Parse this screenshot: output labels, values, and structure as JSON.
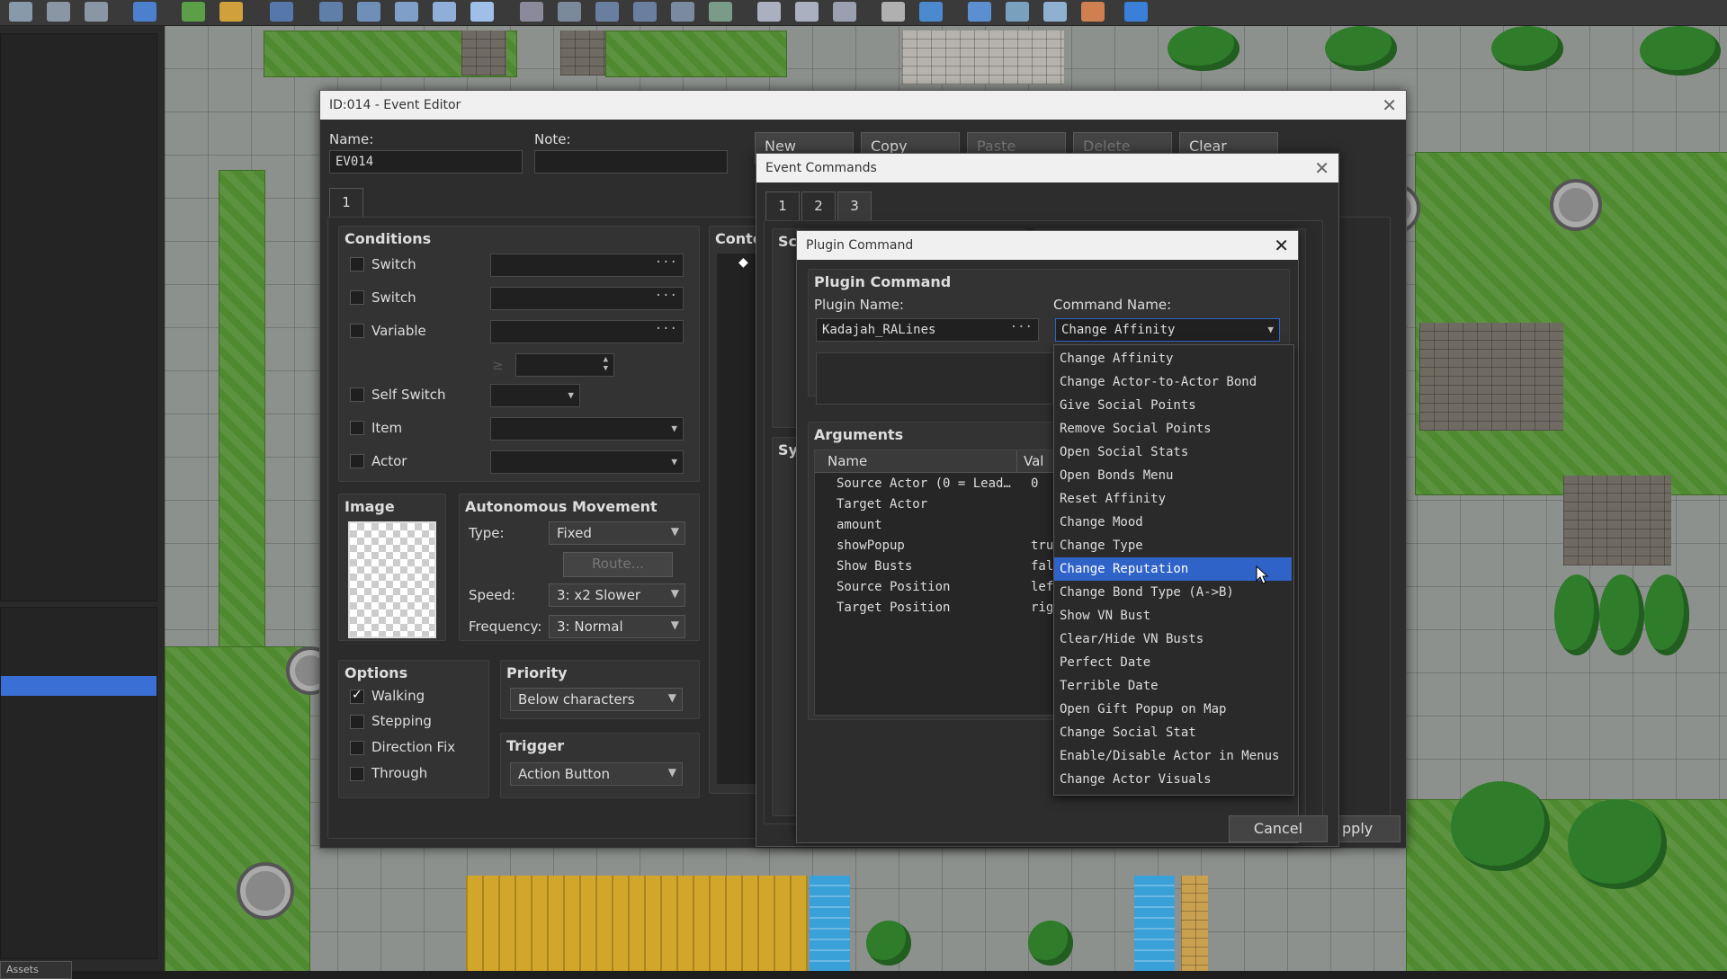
{
  "event_editor": {
    "title": "ID:014 - Event Editor",
    "name_label": "Name:",
    "name_value": "EV014",
    "note_label": "Note:",
    "note_value": "",
    "page_buttons": [
      "New",
      "Copy",
      "Paste",
      "Delete",
      "Clear"
    ],
    "page_tab": "1",
    "conditions": {
      "title": "Conditions",
      "items": [
        {
          "label": "Switch",
          "checked": false
        },
        {
          "label": "Switch",
          "checked": false
        },
        {
          "label": "Variable",
          "checked": false
        },
        {
          "label": "Self Switch",
          "checked": false
        },
        {
          "label": "Item",
          "checked": false
        },
        {
          "label": "Actor",
          "checked": false
        }
      ],
      "ge_symbol": "≥"
    },
    "contents_label": "Conte",
    "image_title": "Image",
    "movement": {
      "title": "Autonomous Movement",
      "type_label": "Type:",
      "type_value": "Fixed",
      "route_button": "Route...",
      "speed_label": "Speed:",
      "speed_value": "3: x2 Slower",
      "frequency_label": "Frequency:",
      "frequency_value": "3: Normal"
    },
    "options": {
      "title": "Options",
      "items": [
        {
          "label": "Walking",
          "checked": true
        },
        {
          "label": "Stepping",
          "checked": false
        },
        {
          "label": "Direction Fix",
          "checked": false
        },
        {
          "label": "Through",
          "checked": false
        }
      ]
    },
    "priority": {
      "title": "Priority",
      "value": "Below characters"
    },
    "trigger": {
      "title": "Trigger",
      "value": "Action Button"
    },
    "apply_button": "pply"
  },
  "event_commands": {
    "title": "Event Commands",
    "tabs": [
      "1",
      "2",
      "3"
    ],
    "panel_label_1": "Sc",
    "panel_label_2": "Sy"
  },
  "plugin_command": {
    "title": "Plugin Command",
    "section_title": "Plugin Command",
    "plugin_name_label": "Plugin Name:",
    "plugin_name_value": "Kadajah_RALines",
    "command_name_label": "Command Name:",
    "command_name_value": "Change Affinity",
    "arguments_title": "Arguments",
    "columns": [
      "Name",
      "Val"
    ],
    "rows": [
      {
        "name": "Source Actor (0 = Lead…",
        "value": "0"
      },
      {
        "name": "Target Actor",
        "value": ""
      },
      {
        "name": "amount",
        "value": ""
      },
      {
        "name": "showPopup",
        "value": "tru"
      },
      {
        "name": "Show Busts",
        "value": "fal"
      },
      {
        "name": "Source Position",
        "value": "lef"
      },
      {
        "name": "Target Position",
        "value": "rig"
      }
    ],
    "cancel_button": "Cancel",
    "dropdown_options": [
      "Change Affinity",
      "Change Actor-to-Actor Bond",
      "Give Social Points",
      "Remove Social Points",
      "Open Social Stats",
      "Open Bonds Menu",
      "Reset Affinity",
      "Change Mood",
      "Change Type",
      "Change Reputation",
      "Change Bond Type (A->B)",
      "Show VN Bust",
      "Clear/Hide VN Busts",
      "Perfect Date",
      "Terrible Date",
      "Open Gift Popup on Map",
      "Change Social Stat",
      "Enable/Disable Actor in Menus",
      "Change Actor Visuals"
    ],
    "highlighted_option": "Change Reputation"
  },
  "left_panel": {
    "bottom_tab": "Assets"
  },
  "colors": {
    "selection": "#2f63c8",
    "accent_left": "#3a6fd6"
  }
}
